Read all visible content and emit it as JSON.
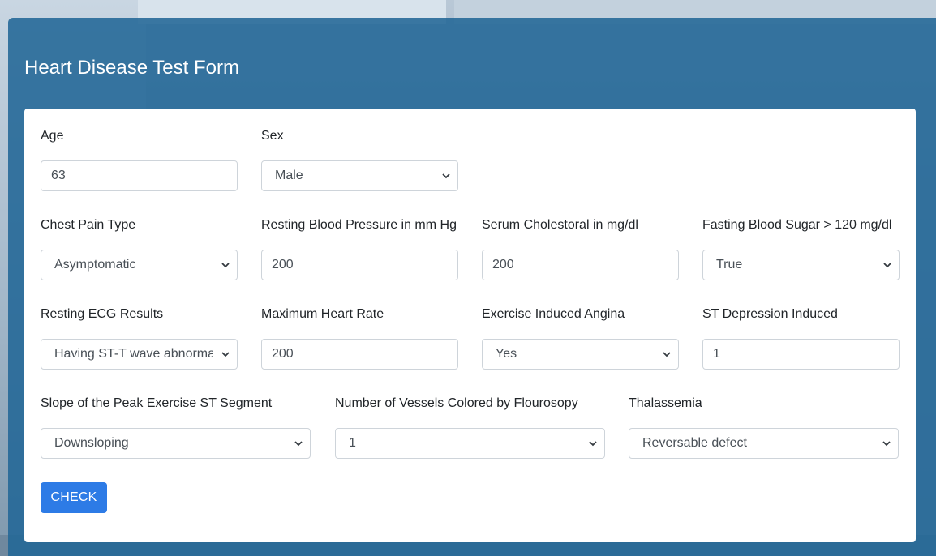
{
  "form": {
    "title": "Heart Disease Test Form",
    "fields": {
      "age": {
        "label": "Age",
        "value": "63"
      },
      "sex": {
        "label": "Sex",
        "value": "Male"
      },
      "chest_pain": {
        "label": "Chest Pain Type",
        "value": "Asymptomatic"
      },
      "resting_bp": {
        "label": "Resting Blood Pressure in mm Hg",
        "value": "200"
      },
      "cholesterol": {
        "label": "Serum Cholestoral in mg/dl",
        "value": "200"
      },
      "fasting_sugar": {
        "label": "Fasting Blood Sugar > 120 mg/dl",
        "value": "True"
      },
      "resting_ecg": {
        "label": "Resting ECG Results",
        "value": "Having ST-T wave abnormality"
      },
      "max_heart_rate": {
        "label": "Maximum Heart Rate",
        "value": "200"
      },
      "exercise_angina": {
        "label": "Exercise Induced Angina",
        "value": "Yes"
      },
      "st_depression": {
        "label": "ST Depression Induced",
        "value": "1"
      },
      "slope": {
        "label": "Slope of the Peak Exercise ST Segment",
        "value": "Downsloping"
      },
      "vessels": {
        "label": "Number of Vessels Colored by Flourosopy",
        "value": "1"
      },
      "thalassemia": {
        "label": "Thalassemia",
        "value": "Reversable defect"
      }
    },
    "submit_label": "CHECK"
  },
  "colors": {
    "panel": "#226696",
    "button": "#2d7be6"
  },
  "icons": {
    "select_arrow": "chevron-down-icon"
  }
}
